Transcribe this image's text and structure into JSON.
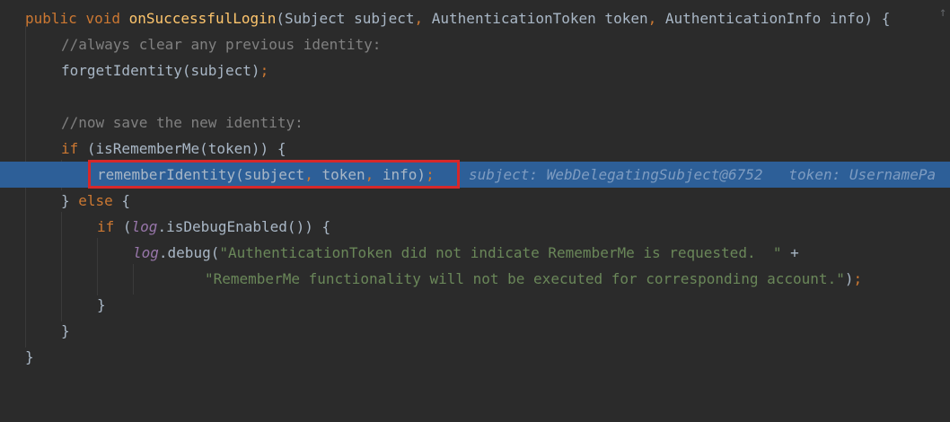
{
  "editor": {
    "lines": [
      {
        "tokens": [
          {
            "t": "public",
            "c": "kw"
          },
          {
            "t": " ",
            "c": "plain"
          },
          {
            "t": "void",
            "c": "kw"
          },
          {
            "t": " ",
            "c": "plain"
          },
          {
            "t": "onSuccessfulLogin",
            "c": "fn"
          },
          {
            "t": "(Subject subject",
            "c": "plain"
          },
          {
            "t": ",",
            "c": "punc"
          },
          {
            "t": " AuthenticationToken token",
            "c": "plain"
          },
          {
            "t": ",",
            "c": "punc"
          },
          {
            "t": " AuthenticationInfo info) {",
            "c": "plain"
          }
        ]
      },
      {
        "tokens": [
          {
            "t": "//always clear any previous identity:",
            "c": "cm"
          }
        ]
      },
      {
        "tokens": [
          {
            "t": "forgetIdentity(subject)",
            "c": "plain"
          },
          {
            "t": ";",
            "c": "punc"
          }
        ]
      },
      {
        "tokens": []
      },
      {
        "tokens": [
          {
            "t": "//now save the new identity:",
            "c": "cm"
          }
        ]
      },
      {
        "tokens": [
          {
            "t": "if",
            "c": "kw"
          },
          {
            "t": " (isRememberMe(token)) {",
            "c": "plain"
          }
        ]
      },
      {
        "tokens": [
          {
            "t": "rememberIdentity(subject",
            "c": "plain"
          },
          {
            "t": ",",
            "c": "punc"
          },
          {
            "t": " token",
            "c": "plain"
          },
          {
            "t": ",",
            "c": "punc"
          },
          {
            "t": " info)",
            "c": "plain"
          },
          {
            "t": ";",
            "c": "punc"
          }
        ]
      },
      {
        "tokens": [
          {
            "t": "} ",
            "c": "plain"
          },
          {
            "t": "else",
            "c": "kw"
          },
          {
            "t": " {",
            "c": "plain"
          }
        ]
      },
      {
        "tokens": [
          {
            "t": "if",
            "c": "kw"
          },
          {
            "t": " (",
            "c": "plain"
          },
          {
            "t": "log",
            "c": "fld"
          },
          {
            "t": ".isDebugEnabled()) {",
            "c": "plain"
          }
        ]
      },
      {
        "tokens": [
          {
            "t": "log",
            "c": "fld"
          },
          {
            "t": ".debug(",
            "c": "plain"
          },
          {
            "t": "\"AuthenticationToken did not indicate RememberMe is requested.  \"",
            "c": "str"
          },
          {
            "t": " +",
            "c": "plain"
          }
        ]
      },
      {
        "tokens": [
          {
            "t": "\"RememberMe functionality will not be executed for corresponding account.\"",
            "c": "str"
          },
          {
            "t": ")",
            "c": "plain"
          },
          {
            "t": ";",
            "c": "punc"
          }
        ]
      },
      {
        "tokens": [
          {
            "t": "}",
            "c": "plain"
          }
        ]
      },
      {
        "tokens": [
          {
            "t": "}",
            "c": "plain"
          }
        ]
      },
      {
        "tokens": [
          {
            "t": "}",
            "c": "plain"
          }
        ]
      }
    ],
    "inline_hint": "subject: WebDelegatingSubject@6752   token: UsernamePa",
    "fold_marker": "↑"
  }
}
